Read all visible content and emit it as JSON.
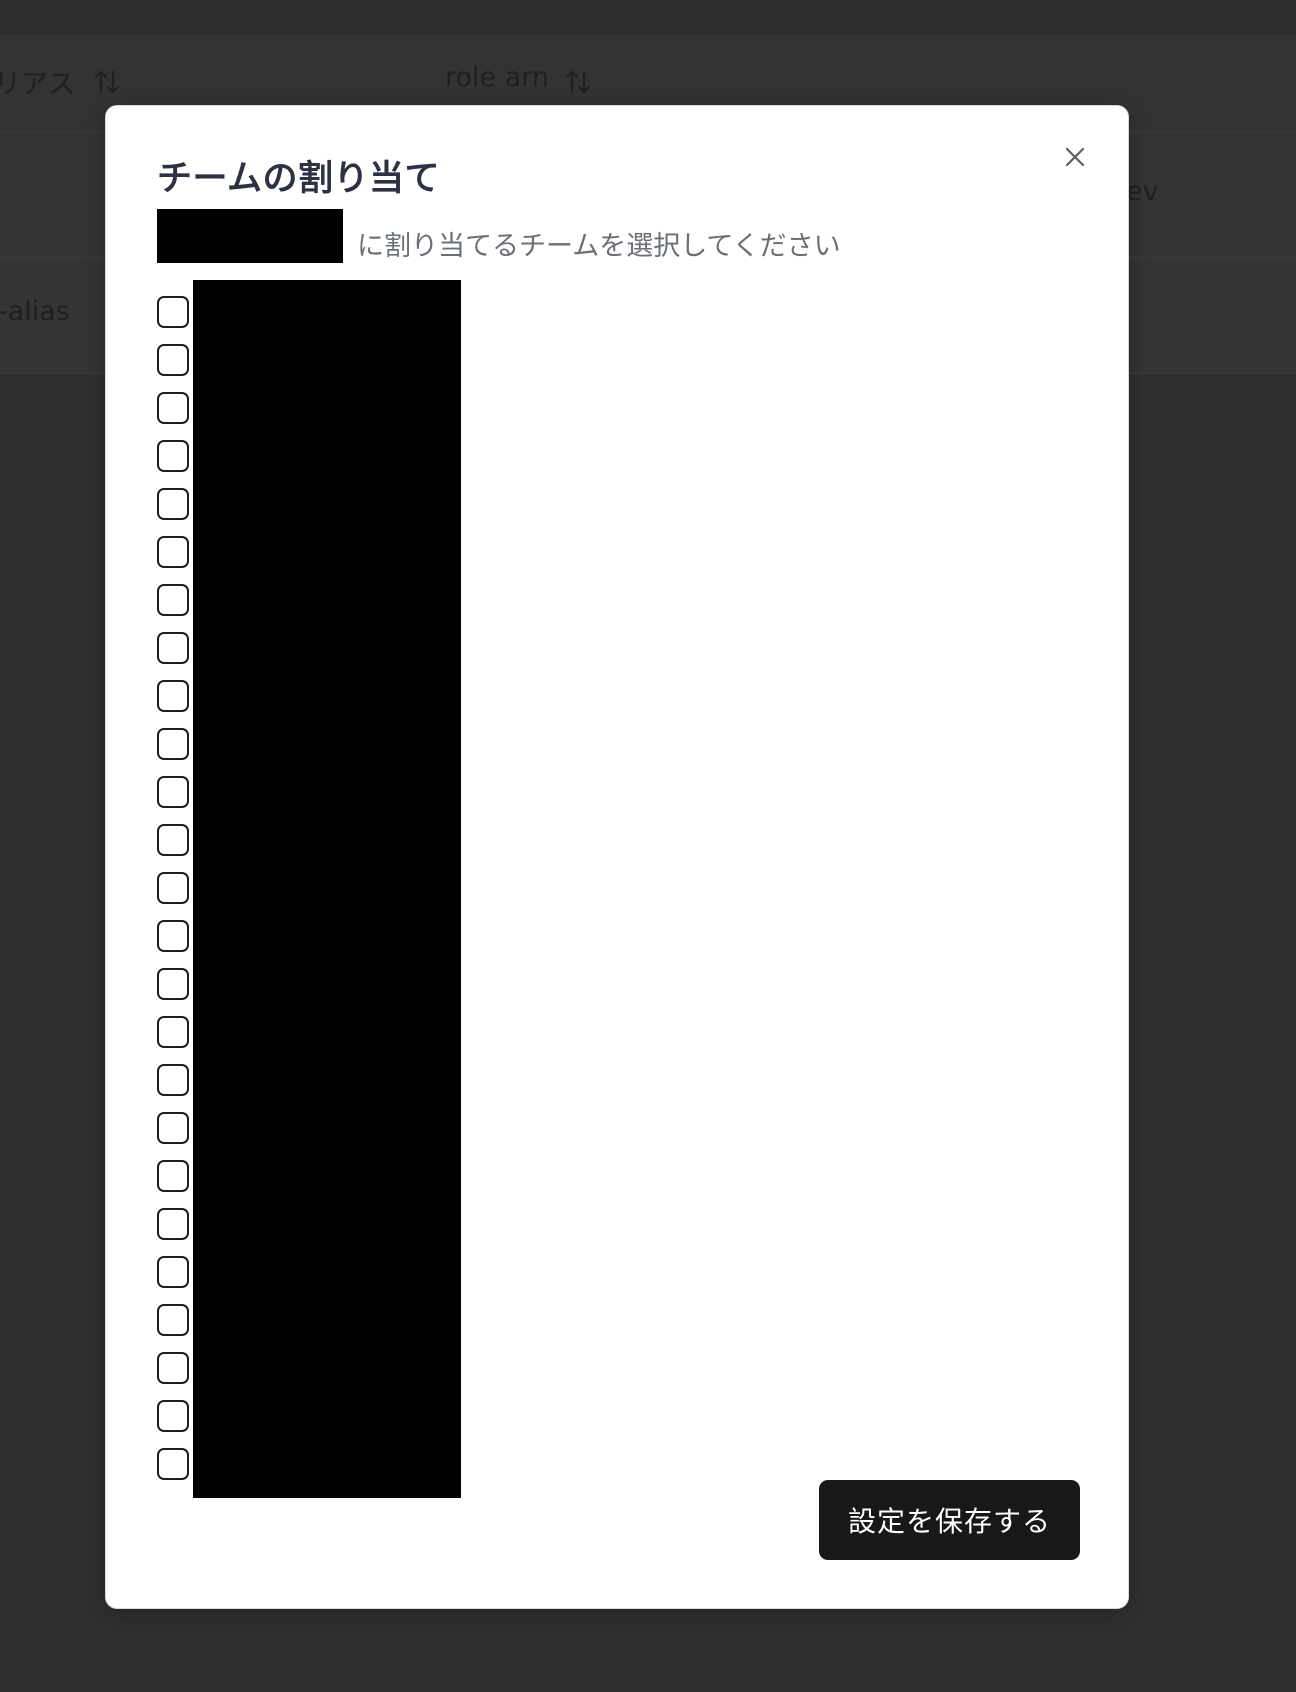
{
  "background_table": {
    "headers": [
      {
        "label": "リアス"
      },
      {
        "label": "role arn"
      }
    ],
    "rows": [
      {
        "cell": "ev"
      },
      {
        "cell": "-alias"
      }
    ]
  },
  "modal": {
    "title": "チームの割り当て",
    "subtitle": "に割り当てるチームを選択してください",
    "save_label": "設定を保存する",
    "teams": [
      {
        "checked": false
      },
      {
        "checked": false
      },
      {
        "checked": false
      },
      {
        "checked": false
      },
      {
        "checked": false
      },
      {
        "checked": false
      },
      {
        "checked": false
      },
      {
        "checked": false
      },
      {
        "checked": false
      },
      {
        "checked": false
      },
      {
        "checked": false
      },
      {
        "checked": false
      },
      {
        "checked": false
      },
      {
        "checked": false
      },
      {
        "checked": false
      },
      {
        "checked": false
      },
      {
        "checked": false
      },
      {
        "checked": false
      },
      {
        "checked": false
      },
      {
        "checked": false
      },
      {
        "checked": false
      },
      {
        "checked": false
      },
      {
        "checked": false
      },
      {
        "checked": false
      },
      {
        "checked": false
      }
    ]
  },
  "icons": {
    "close": "close-icon",
    "sort": "sort-arrows-icon"
  }
}
